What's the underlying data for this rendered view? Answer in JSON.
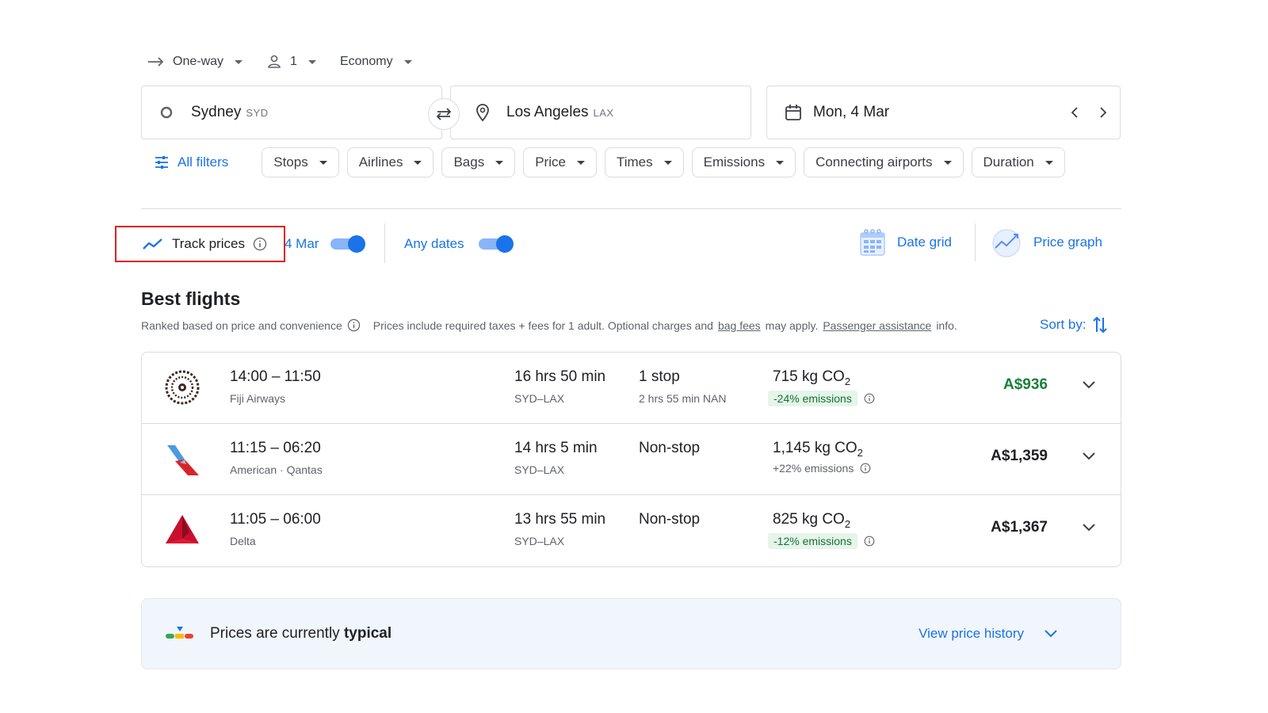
{
  "trip": {
    "type_label": "One-way",
    "passengers": "1",
    "cabin": "Economy"
  },
  "search": {
    "from_city": "Sydney",
    "from_code": "SYD",
    "to_city": "Los Angeles",
    "to_code": "LAX",
    "date": "Mon, 4 Mar"
  },
  "filters": {
    "all_label": "All filters",
    "chips": [
      "Stops",
      "Airlines",
      "Bags",
      "Price",
      "Times",
      "Emissions",
      "Connecting airports",
      "Duration"
    ]
  },
  "tracking": {
    "track_label": "Track prices",
    "date_label": "4 Mar",
    "any_dates_label": "Any dates",
    "date_grid_label": "Date grid",
    "price_graph_label": "Price graph"
  },
  "results": {
    "title": "Best flights",
    "ranked_text": "Ranked based on price and convenience",
    "prices_text_1": "Prices include required taxes + fees for 1 adult. Optional charges and",
    "bag_fees_link": "bag fees",
    "prices_text_2": "may apply.",
    "assistance_link": "Passenger assistance",
    "prices_text_3": "info.",
    "sort_label": "Sort by:"
  },
  "flights": [
    {
      "times": "14:00 – 11:50",
      "airline": "Fiji Airways",
      "duration": "16 hrs 50 min",
      "route": "SYD–LAX",
      "stops": "1 stop",
      "stop_detail": "2 hrs 55 min NAN",
      "co2_value": "715 kg CO",
      "co2_sub": "2",
      "emissions": "-24% emissions",
      "price": "A$936"
    },
    {
      "times": "11:15 – 06:20",
      "airline": "American · Qantas",
      "duration": "14 hrs 5 min",
      "route": "SYD–LAX",
      "stops": "Non-stop",
      "stop_detail": "",
      "co2_value": "1,145 kg CO",
      "co2_sub": "2",
      "emissions": "+22% emissions",
      "price": "A$1,359"
    },
    {
      "times": "11:05 – 06:00",
      "airline": "Delta",
      "duration": "13 hrs 55 min",
      "route": "SYD–LAX",
      "stops": "Non-stop",
      "stop_detail": "",
      "co2_value": "825 kg CO",
      "co2_sub": "2",
      "emissions": "-12% emissions",
      "price": "A$1,367"
    }
  ],
  "insight": {
    "text_prefix": "Prices are currently",
    "text_bold": "typical",
    "history_link": "View price history"
  },
  "colors": {
    "accent": "#1a73e8",
    "good_price": "#188038",
    "highlight_border": "#e02020",
    "emission_badge_bg": "#e6f4ea"
  },
  "icons": {
    "trip_type": "arrow-right-icon",
    "passenger": "person-icon",
    "origin": "circle-icon",
    "swap": "swap-arrows-icon",
    "destination": "location-pin-icon",
    "calendar": "calendar-icon",
    "filters": "sliders-icon",
    "track": "trend-line-icon",
    "info": "info-icon",
    "date_grid": "grid-calendar-icon",
    "price_graph": "graph-icon",
    "sort": "sort-arrows-icon",
    "expand": "chevron-down-icon",
    "insight": "price-level-icon"
  }
}
